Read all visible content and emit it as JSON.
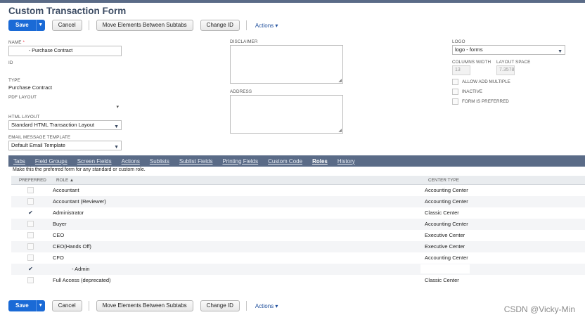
{
  "page": {
    "title": "Custom Transaction Form"
  },
  "toolbar": {
    "save_label": "Save",
    "cancel_label": "Cancel",
    "move_label": "Move Elements Between Subtabs",
    "change_id_label": "Change ID",
    "actions_label": "Actions"
  },
  "form": {
    "name_label": "NAME",
    "name_required": "*",
    "name_value": "- Purchase Contract",
    "id_label": "ID",
    "type_label": "TYPE",
    "type_value": "Purchase Contract",
    "pdf_layout_label": "PDF LAYOUT",
    "html_layout_label": "HTML LAYOUT",
    "html_layout_value": "Standard HTML Transaction Layout",
    "email_label": "EMAIL MESSAGE TEMPLATE",
    "email_value": "Default Email Template",
    "disclaimer_label": "DISCLAIMER",
    "address_label": "ADDRESS",
    "logo_label": "LOGO",
    "logo_value": "logo - forms",
    "columns_width_label": "COLUMNS WIDTH",
    "columns_width_value": "13",
    "layout_space_label": "LAYOUT SPACE",
    "layout_space_value": "7.3578",
    "allow_add_multiple_label": "ALLOW ADD MULTIPLE",
    "inactive_label": "INACTIVE",
    "form_is_preferred_label": "FORM IS PREFERRED"
  },
  "tabs": [
    {
      "label": "Tabs"
    },
    {
      "label": "Field Groups"
    },
    {
      "label": "Screen Fields"
    },
    {
      "label": "Actions"
    },
    {
      "label": "Sublists"
    },
    {
      "label": "Sublist Fields"
    },
    {
      "label": "Printing Fields"
    },
    {
      "label": "Custom Code"
    },
    {
      "label": "Roles"
    },
    {
      "label": "History"
    }
  ],
  "active_tab": "Roles",
  "roles": {
    "hint": "Make this the preferred form for any standard or custom role.",
    "columns": {
      "preferred": "PREFERRED",
      "role": "ROLE ▲",
      "center": "CENTER TYPE"
    },
    "rows": [
      {
        "role": "Accountant",
        "center": "Accounting Center",
        "checked": false
      },
      {
        "role": "Accountant (Reviewer)",
        "center": "Accounting Center",
        "checked": false
      },
      {
        "role": "Administrator",
        "center": "Classic Center",
        "checked": true
      },
      {
        "role": "Buyer",
        "center": "Accounting Center",
        "checked": false
      },
      {
        "role": "CEO",
        "center": "Executive Center",
        "checked": false
      },
      {
        "role": "CEO(Hands Off)",
        "center": "Executive Center",
        "checked": false
      },
      {
        "role": "CFO",
        "center": "Accounting Center",
        "checked": false
      },
      {
        "role": "- Admin",
        "center": "",
        "checked": true
      },
      {
        "role": "Full Access (deprecated)",
        "center": "Classic Center",
        "checked": false
      }
    ]
  },
  "watermark": "CSDN @Vicky-Min"
}
